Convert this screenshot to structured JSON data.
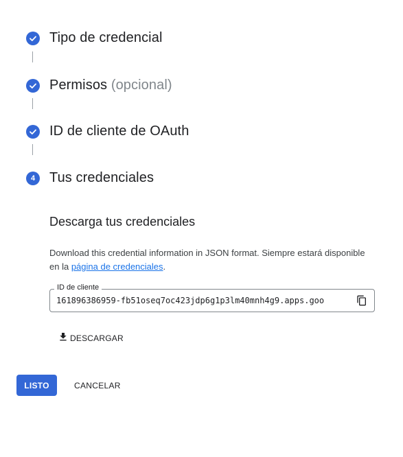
{
  "stepper": {
    "steps": [
      {
        "label": "Tipo de credencial",
        "status": "completed"
      },
      {
        "label": "Permisos",
        "optional_text": "(opcional)",
        "status": "completed"
      },
      {
        "label": "ID de cliente de OAuth",
        "status": "completed"
      },
      {
        "label": "Tus credenciales",
        "number": "4",
        "status": "active"
      }
    ]
  },
  "download_section": {
    "title": "Descarga tus credenciales",
    "description_prefix": "Download this credential information in JSON format. Siempre estará disponible en la ",
    "link_text": "página de credenciales",
    "description_suffix": "."
  },
  "client_id_field": {
    "label": "ID de cliente",
    "value": "161896386959-fb51oseq7oc423jdp6g1p3lm40mnh4g9.apps.goo"
  },
  "download_button": {
    "label": "DESCARGAR"
  },
  "actions": {
    "done_label": "LISTO",
    "cancel_label": "CANCELAR"
  },
  "colors": {
    "accent": "#3367d6",
    "link": "#1a73e8",
    "connector": "#9aa0a6"
  }
}
